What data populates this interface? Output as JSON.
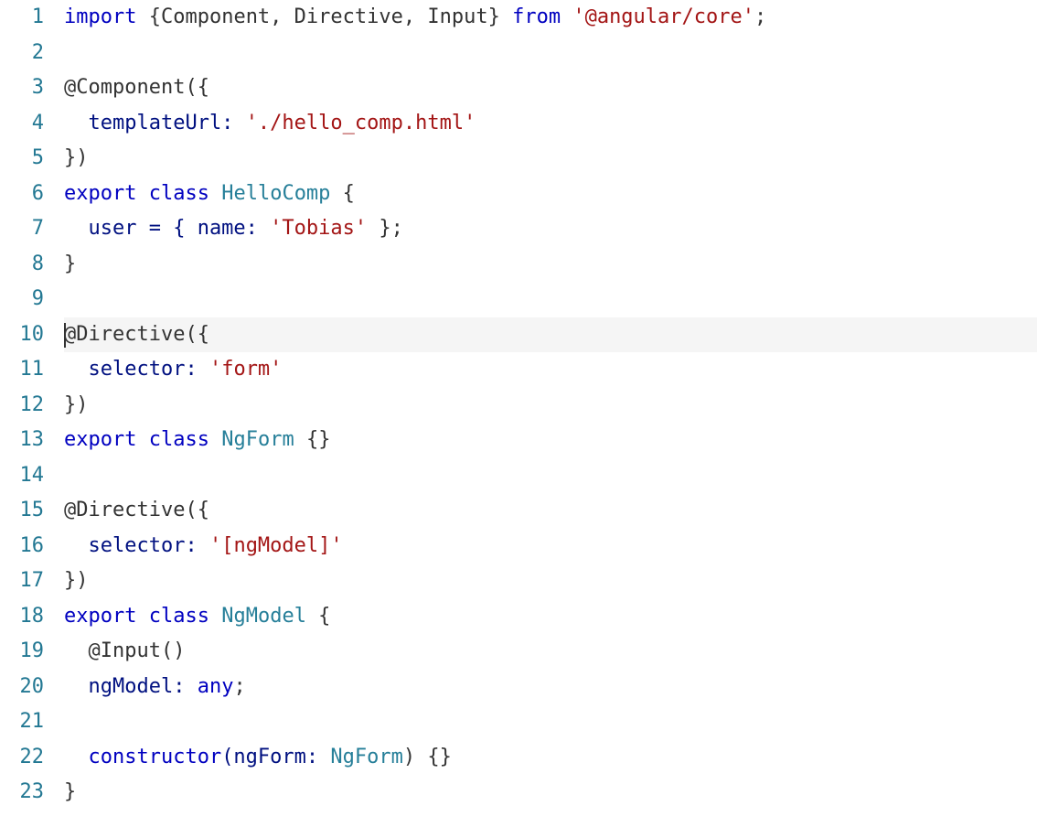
{
  "lineNumbers": [
    "1",
    "2",
    "3",
    "4",
    "5",
    "6",
    "7",
    "8",
    "9",
    "10",
    "11",
    "12",
    "13",
    "14",
    "15",
    "16",
    "17",
    "18",
    "19",
    "20",
    "21",
    "22",
    "23"
  ],
  "activeLine": 10,
  "code": {
    "l1": {
      "t1": "import",
      "t2": " {Component, Directive, Input} ",
      "t3": "from",
      "t4": " ",
      "t5": "'@angular/core'",
      "t6": ";"
    },
    "l2": {
      "t1": ""
    },
    "l3": {
      "t1": "@Component",
      "t2": "({"
    },
    "l4": {
      "t1": "  templateUrl: ",
      "t2": "'./hello_comp.html'"
    },
    "l5": {
      "t1": "})"
    },
    "l6": {
      "t1": "export",
      "t2": " ",
      "t3": "class",
      "t4": " ",
      "t5": "HelloComp",
      "t6": " {"
    },
    "l7": {
      "t1": "  user = { name: ",
      "t2": "'Tobias'",
      "t3": " };"
    },
    "l8": {
      "t1": "}"
    },
    "l9": {
      "t1": ""
    },
    "l10": {
      "t1": "@Directive",
      "t2": "({"
    },
    "l11": {
      "t1": "  selector: ",
      "t2": "'form'"
    },
    "l12": {
      "t1": "})"
    },
    "l13": {
      "t1": "export",
      "t2": " ",
      "t3": "class",
      "t4": " ",
      "t5": "NgForm",
      "t6": " {}"
    },
    "l14": {
      "t1": ""
    },
    "l15": {
      "t1": "@Directive",
      "t2": "({"
    },
    "l16": {
      "t1": "  selector: ",
      "t2": "'[ngModel]'"
    },
    "l17": {
      "t1": "})"
    },
    "l18": {
      "t1": "export",
      "t2": " ",
      "t3": "class",
      "t4": " ",
      "t5": "NgModel",
      "t6": " {"
    },
    "l19": {
      "t1": "  @Input",
      "t2": "()"
    },
    "l20": {
      "t1": "  ngModel: ",
      "t2": "any",
      "t3": ";"
    },
    "l21": {
      "t1": ""
    },
    "l22": {
      "t1": "  constructor",
      "t2": "(ngForm: ",
      "t3": "NgForm",
      "t4": ") {}"
    },
    "l23": {
      "t1": "}"
    }
  }
}
